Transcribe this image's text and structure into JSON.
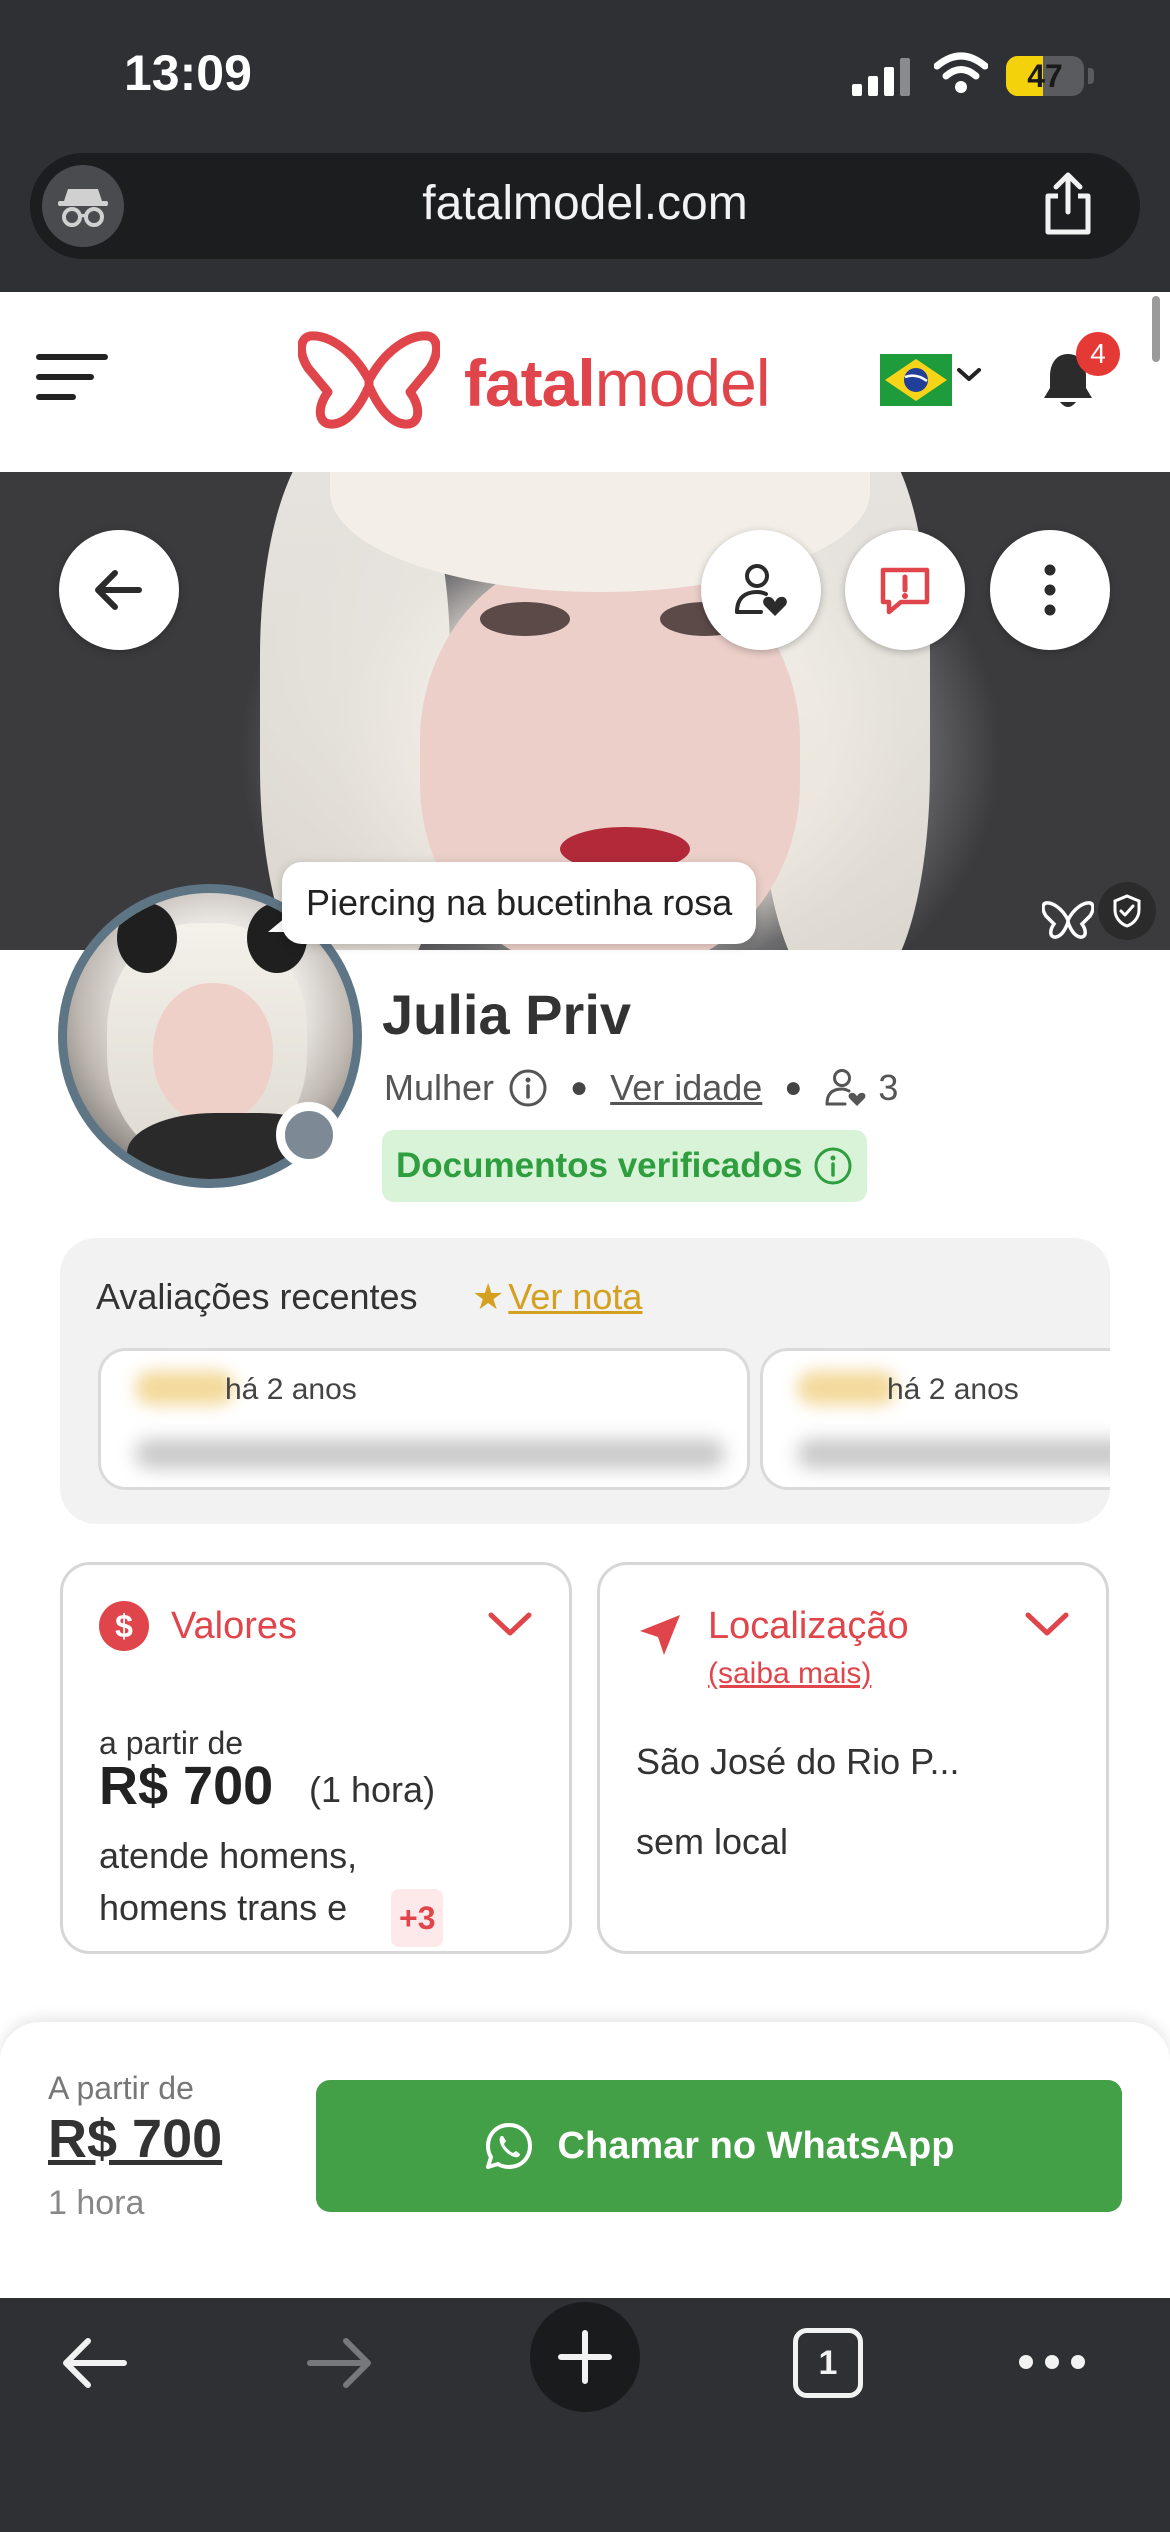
{
  "status_bar": {
    "time": "13:09",
    "battery": "47",
    "battery_level": 0.47
  },
  "browser": {
    "url": "fatalmodel.com",
    "tabs_count": "1"
  },
  "header": {
    "logo_bold": "fatal",
    "logo_light": "model",
    "notification_count": "4",
    "flag": "brazil-flag-icon"
  },
  "profile": {
    "bubble": "Piercing na bucetinha rosa",
    "name": "Julia Priv",
    "gender": "Mulher",
    "age_link": "Ver idade",
    "followers": "3",
    "verified": "Documentos verificados"
  },
  "reviews": {
    "title": "Avaliações recentes",
    "star": "★",
    "link": "Ver nota",
    "items": [
      {
        "time": "há 2 anos"
      },
      {
        "time": "há 2 anos"
      }
    ]
  },
  "values_card": {
    "title": "Valores",
    "from": "a partir de",
    "price": "R$ 700",
    "duration": "(1 hora)",
    "serves_line1": "atende homens,",
    "serves_line2": "homens trans e",
    "more": "+3"
  },
  "location_card": {
    "title": "Localização",
    "sub": "(saiba mais)",
    "city": "São José do Rio P...",
    "place": "sem local"
  },
  "sticky": {
    "label": "A partir de",
    "price": "R$ 700",
    "unit": "1 hora",
    "whatsapp": "Chamar no WhatsApp"
  },
  "colors": {
    "brand": "#e0454b",
    "whatsapp": "#43a047",
    "verified_bg": "#d8f3d8",
    "verified_text": "#2e9e3e",
    "review_link": "#d4a020",
    "chrome": "#2e3034"
  }
}
